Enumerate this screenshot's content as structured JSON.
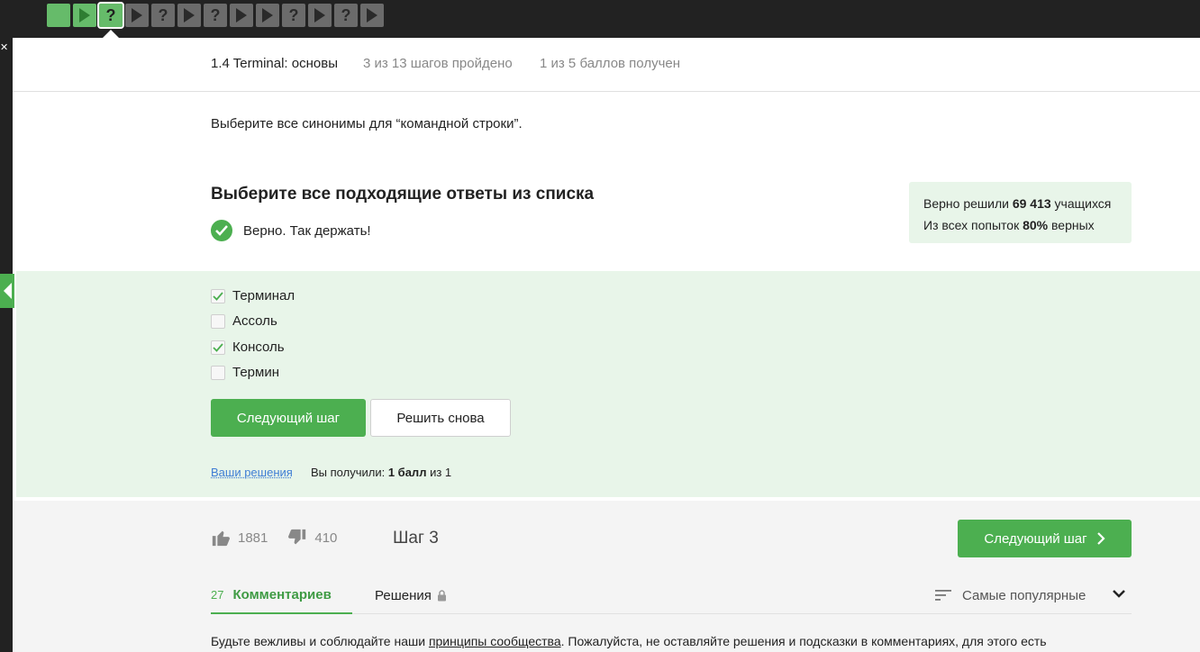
{
  "step_bar": {
    "steps": [
      {
        "type": "done"
      },
      {
        "type": "video",
        "state": "done"
      },
      {
        "type": "quiz",
        "state": "current",
        "glyph": "?"
      },
      {
        "type": "video"
      },
      {
        "type": "quiz",
        "glyph": "?"
      },
      {
        "type": "video"
      },
      {
        "type": "quiz",
        "glyph": "?"
      },
      {
        "type": "video"
      },
      {
        "type": "video"
      },
      {
        "type": "quiz",
        "glyph": "?"
      },
      {
        "type": "video"
      },
      {
        "type": "quiz",
        "glyph": "?"
      },
      {
        "type": "video"
      }
    ]
  },
  "header": {
    "lesson_title": "1.4 Terminal: основы",
    "progress_steps": "3 из 13 шагов пройдено",
    "progress_score": "1 из 5 баллов  получен"
  },
  "question": {
    "text": "Выберите все синонимы для “командной строки”."
  },
  "quiz": {
    "title": "Выберите все подходящие ответы из списка",
    "result": "Верно. Так держать!",
    "options": [
      {
        "label": "Терминал",
        "checked": true
      },
      {
        "label": "Ассоль",
        "checked": false
      },
      {
        "label": "Консоль",
        "checked": true
      },
      {
        "label": "Термин",
        "checked": false
      }
    ],
    "next_button": "Следующий шаг",
    "retry_button": "Решить снова",
    "your_solutions_link": "Ваши решения",
    "score_prefix": "Вы получили:",
    "score_value": "1 балл",
    "score_suffix": "из 1"
  },
  "stats": {
    "line1_prefix": "Верно решили",
    "line1_value": "69 413",
    "line1_suffix": "учащихся",
    "line2_prefix": "Из всех попыток",
    "line2_value": "80%",
    "line2_suffix": "верных"
  },
  "footer": {
    "likes": "1881",
    "dislikes": "410",
    "step_label": "Шаг 3",
    "next_button": "Следующий шаг",
    "tabs": {
      "comments_count": "27",
      "comments_label": "Комментариев",
      "solutions_label": "Решения"
    },
    "sort_label": "Самые популярные",
    "notice_prefix": "Будьте вежливы и соблюдайте наши ",
    "notice_link": "принципы сообщества",
    "notice_suffix": ". Пожалуйста, не оставляйте решения и подсказки в комментариях, для этого есть"
  },
  "colors": {
    "accent": "#4caf50",
    "accent_light": "#e8f5e9",
    "topbar": "#222222",
    "link": "#3f7dd4"
  },
  "icons": [
    "check-circle-icon",
    "thumbs-up-icon",
    "thumbs-down-icon",
    "lock-icon",
    "sort-icon",
    "chevron-down-icon",
    "chevron-right-icon",
    "play-icon",
    "question-icon",
    "close-icon",
    "collapse-left-icon"
  ]
}
